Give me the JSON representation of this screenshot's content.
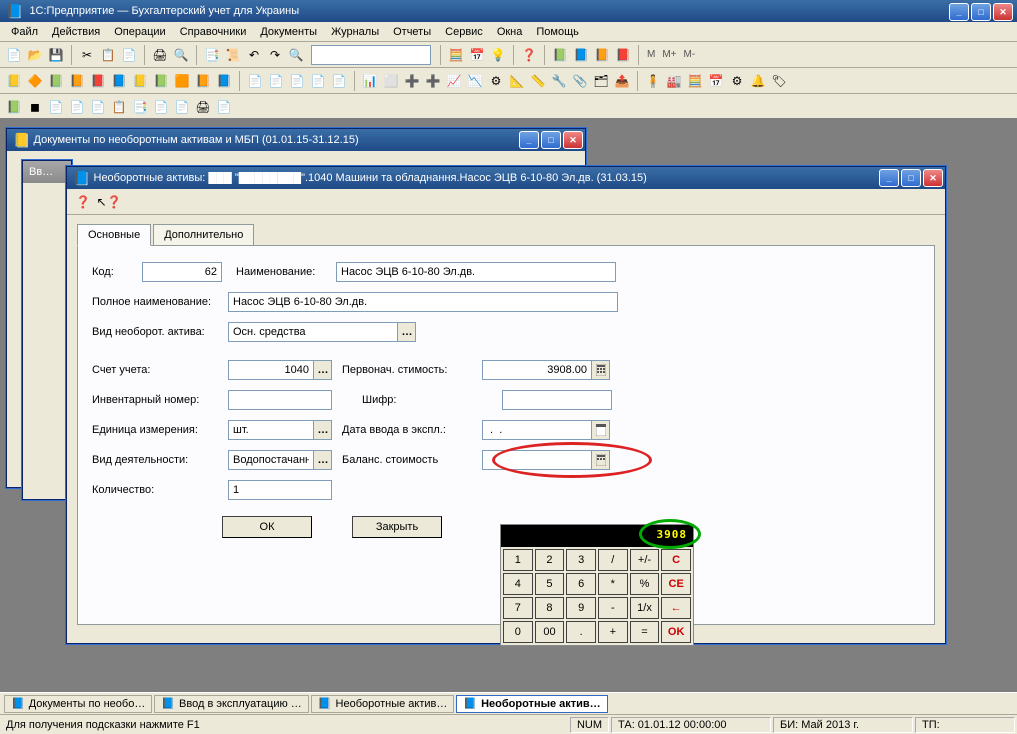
{
  "app": {
    "title": "1С:Предприятие — Бухгалтерский учет для Украины"
  },
  "menu": {
    "items": [
      "Файл",
      "Действия",
      "Операции",
      "Справочники",
      "Документы",
      "Журналы",
      "Отчеты",
      "Сервис",
      "Окна",
      "Помощь"
    ]
  },
  "toolbar_hint": {
    "m1": "M",
    "m2": "M+",
    "m3": "M-"
  },
  "bg_window": {
    "title": "Документы по необоротным активам и МБП (01.01.15-31.12.15)"
  },
  "bg_window2": {
    "title": "Вв…"
  },
  "dlg": {
    "title": "Необоротные активы: ███ \"████████\".1040 Машини та обладнання.Насос ЭЦВ 6-10-80 Эл.дв. (31.03.15)",
    "tabs": {
      "t1": "Основные",
      "t2": "Дополнительно"
    },
    "labels": {
      "code": "Код:",
      "name": "Наименование:",
      "fullname": "Полное наименование:",
      "assettype": "Вид необорот. актива:",
      "account": "Счет учета:",
      "initcost": "Первонач. стимость:",
      "invno": "Инвентарный номер:",
      "cipher": "Шифр:",
      "unit": "Единица измерения:",
      "startdate": "Дата ввода в экспл.:",
      "activity": "Вид деятельности:",
      "balance": "Баланс. стоимость",
      "qty": "Количество:"
    },
    "values": {
      "code": "62",
      "name": "Насос ЭЦВ 6-10-80 Эл.дв.",
      "fullname": "Насос ЭЦВ 6-10-80 Эл.дв.",
      "assettype": "Осн. средства",
      "account": "1040",
      "initcost": "3908.00",
      "invno": "",
      "cipher": "",
      "unit": "шт.",
      "startdate": " .  .  ",
      "activity": "Водопостачання",
      "balance": "",
      "qty": "1"
    },
    "buttons": {
      "ok": "ОК",
      "close": "Закрыть"
    }
  },
  "calc": {
    "display": "3908",
    "keys": [
      [
        "1",
        "2",
        "3",
        "/",
        "+/-",
        "C"
      ],
      [
        "4",
        "5",
        "6",
        "*",
        "%",
        "CE"
      ],
      [
        "7",
        "8",
        "9",
        "-",
        "1/x",
        "←"
      ],
      [
        "0",
        "00",
        ".",
        "+",
        "=",
        "OK"
      ]
    ]
  },
  "taskbar": {
    "items": [
      {
        "label": "Документы по необо…",
        "active": false
      },
      {
        "label": "Ввод в эксплуатацию …",
        "active": false
      },
      {
        "label": "Необоротные актив…",
        "active": false
      },
      {
        "label": "Необоротные актив…",
        "active": true
      }
    ]
  },
  "status": {
    "help": "Для получения подсказки нажмите F1",
    "num": "NUM",
    "ta": "ТА: 01.01.12  00:00:00",
    "bi": "БИ: Май 2013 г.",
    "tp": "ТП:"
  }
}
